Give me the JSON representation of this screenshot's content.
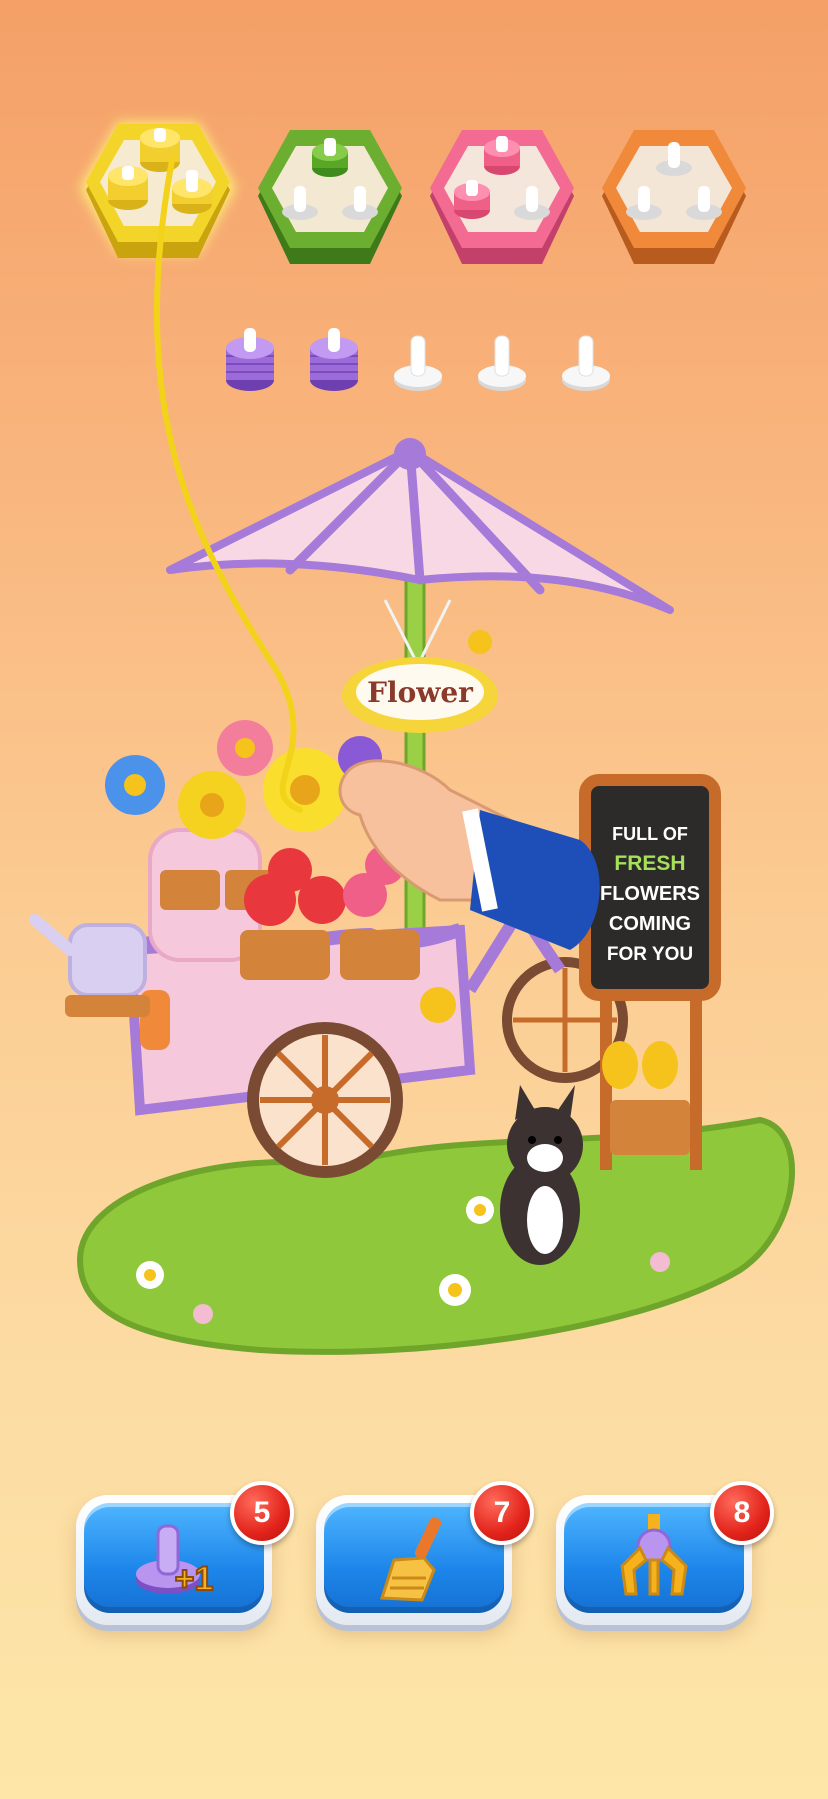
{
  "colors": {
    "yellow": "#f3d52a",
    "green": "#6cae2f",
    "pink": "#f36a92",
    "orange": "#f08a3a",
    "purple": "#9c6bd8",
    "button_blue": "#1d86ea",
    "badge_red": "#e2231a"
  },
  "hexagons": [
    {
      "color": "yellow",
      "selected": true,
      "pegs": [
        "yellow-stack",
        "yellow-stack",
        "yellow-stack"
      ]
    },
    {
      "color": "green",
      "selected": false,
      "pegs": [
        "green-stack",
        "empty",
        "empty"
      ]
    },
    {
      "color": "pink",
      "selected": false,
      "pegs": [
        "pink-stack",
        "pink-stack",
        "empty"
      ]
    },
    {
      "color": "orange",
      "selected": false,
      "pegs": [
        "empty",
        "empty",
        "empty"
      ]
    }
  ],
  "spare_pegs": [
    "purple-stack",
    "purple-stack",
    "empty",
    "empty",
    "empty"
  ],
  "scene": {
    "umbrella_sign": "Flower",
    "board_lines": [
      "FULL OF",
      "FRESH",
      "FLOWERS",
      "COMING",
      "FOR YOU"
    ]
  },
  "powerups": [
    {
      "name": "add-peg",
      "icon": "peg-plus-one-icon",
      "count": "5",
      "icon_label": "+1"
    },
    {
      "name": "broom",
      "icon": "broom-icon",
      "count": "7"
    },
    {
      "name": "claw",
      "icon": "claw-icon",
      "count": "8"
    }
  ]
}
